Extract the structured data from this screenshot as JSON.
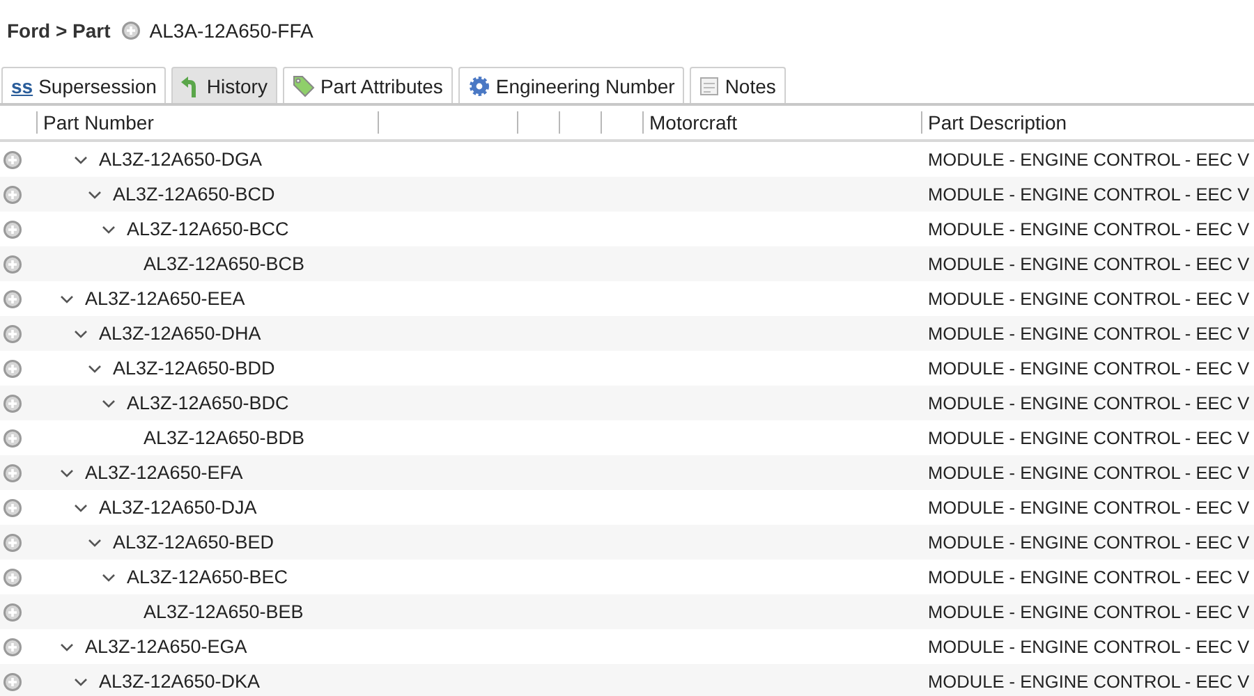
{
  "breadcrumb": {
    "path": "Ford > Part",
    "part": "AL3A-12A650-FFA"
  },
  "tabs": [
    {
      "label": "Supersession",
      "kind": "ss",
      "icon_text": "ss",
      "selected": false
    },
    {
      "label": "History",
      "kind": "history",
      "selected": true
    },
    {
      "label": "Part Attributes",
      "kind": "tag",
      "selected": false
    },
    {
      "label": "Engineering Number",
      "kind": "gear",
      "selected": false
    },
    {
      "label": "Notes",
      "kind": "notes",
      "selected": false
    }
  ],
  "table": {
    "columns": {
      "part_number": "Part Number",
      "motorcraft": "Motorcraft",
      "part_description": "Part Description"
    },
    "continued_branch": [
      {
        "part_number": "AL3Z-12A650-DGA",
        "description": "MODULE - ENGINE CONTROL - EEC V",
        "expanded": true,
        "children": [
          {
            "part_number": "AL3Z-12A650-BCD",
            "description": "MODULE - ENGINE CONTROL - EEC V",
            "expanded": true,
            "children": [
              {
                "part_number": "AL3Z-12A650-BCC",
                "description": "MODULE - ENGINE CONTROL - EEC V",
                "expanded": true,
                "children": [
                  {
                    "part_number": "AL3Z-12A650-BCB",
                    "description": "MODULE - ENGINE CONTROL - EEC V"
                  }
                ]
              }
            ]
          }
        ]
      }
    ],
    "rows": [
      {
        "part_number": "AL3Z-12A650-EEA",
        "description": "MODULE - ENGINE CONTROL - EEC V",
        "expanded": true,
        "children": [
          {
            "part_number": "AL3Z-12A650-DHA",
            "description": "MODULE - ENGINE CONTROL - EEC V",
            "expanded": true,
            "children": [
              {
                "part_number": "AL3Z-12A650-BDD",
                "description": "MODULE - ENGINE CONTROL - EEC V",
                "expanded": true,
                "children": [
                  {
                    "part_number": "AL3Z-12A650-BDC",
                    "description": "MODULE - ENGINE CONTROL - EEC V",
                    "expanded": true,
                    "children": [
                      {
                        "part_number": "AL3Z-12A650-BDB",
                        "description": "MODULE - ENGINE CONTROL - EEC V"
                      }
                    ]
                  }
                ]
              }
            ]
          }
        ]
      },
      {
        "part_number": "AL3Z-12A650-EFA",
        "description": "MODULE - ENGINE CONTROL - EEC V",
        "expanded": true,
        "children": [
          {
            "part_number": "AL3Z-12A650-DJA",
            "description": "MODULE - ENGINE CONTROL - EEC V",
            "expanded": true,
            "children": [
              {
                "part_number": "AL3Z-12A650-BED",
                "description": "MODULE - ENGINE CONTROL - EEC V",
                "expanded": true,
                "children": [
                  {
                    "part_number": "AL3Z-12A650-BEC",
                    "description": "MODULE - ENGINE CONTROL - EEC V",
                    "expanded": true,
                    "children": [
                      {
                        "part_number": "AL3Z-12A650-BEB",
                        "description": "MODULE - ENGINE CONTROL - EEC V"
                      }
                    ]
                  }
                ]
              }
            ]
          }
        ]
      },
      {
        "part_number": "AL3Z-12A650-EGA",
        "description": "MODULE - ENGINE CONTROL - EEC V",
        "expanded": true,
        "children": [
          {
            "part_number": "AL3Z-12A650-DKA",
            "description": "MODULE - ENGINE CONTROL - EEC V",
            "expanded": true
          }
        ]
      }
    ]
  }
}
